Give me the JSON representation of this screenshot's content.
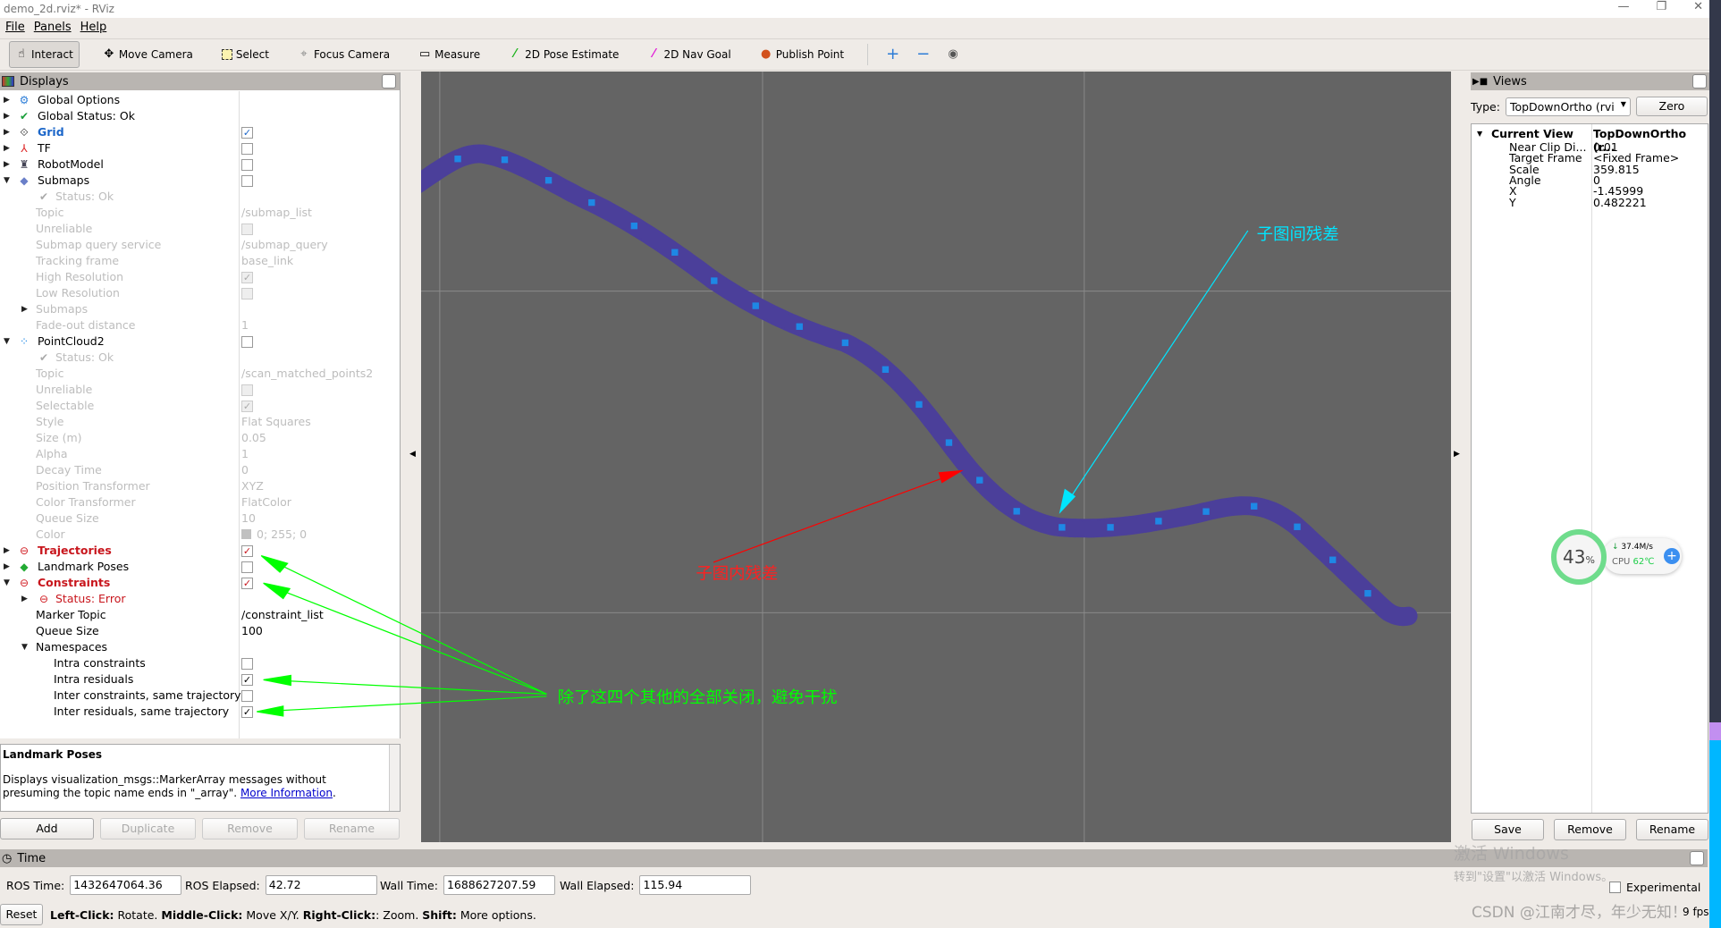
{
  "window": {
    "title": "demo_2d.rviz* - RViz",
    "controls": [
      "—",
      "❐",
      "✕"
    ]
  },
  "menu": [
    "File",
    "Panels",
    "Help"
  ],
  "toolbar": [
    {
      "label": "Interact",
      "icon": "hand-icon",
      "active": true
    },
    {
      "label": "Move Camera",
      "icon": "move-camera-icon"
    },
    {
      "label": "Select",
      "icon": "select-icon"
    },
    {
      "label": "Focus Camera",
      "icon": "focus-camera-icon"
    },
    {
      "label": "Measure",
      "icon": "ruler-icon"
    },
    {
      "label": "2D Pose Estimate",
      "icon": "green-arrow-icon"
    },
    {
      "label": "2D Nav Goal",
      "icon": "magenta-arrow-icon"
    },
    {
      "label": "Publish Point",
      "icon": "map-pin-icon"
    }
  ],
  "displays": {
    "title": "Displays",
    "rows": [
      {
        "label": "Global Options",
        "level": 0,
        "exp": "closed",
        "icon": "gear-icon"
      },
      {
        "label": "Global Status: Ok",
        "level": 0,
        "exp": "closed",
        "icon": "check-icon"
      },
      {
        "label": "Grid",
        "level": 0,
        "exp": "closed",
        "icon": "grid-icon",
        "style": "blue",
        "cb": "checked"
      },
      {
        "label": "TF",
        "level": 0,
        "exp": "closed",
        "icon": "tf-axes-icon",
        "cb": "unchecked"
      },
      {
        "label": "RobotModel",
        "level": 0,
        "exp": "closed",
        "icon": "robot-icon",
        "cb": "unchecked"
      },
      {
        "label": "Submaps",
        "level": 0,
        "exp": "open",
        "icon": "submaps-icon",
        "cb": "unchecked"
      },
      {
        "label": "Status: Ok",
        "level": 1,
        "icon": "check-icon",
        "style": "dis"
      },
      {
        "label": "Topic",
        "level": 1,
        "value": "/submap_list",
        "style": "dis"
      },
      {
        "label": "Unreliable",
        "level": 1,
        "cb": "unchecked",
        "style": "dis"
      },
      {
        "label": "Submap query service",
        "level": 1,
        "value": "/submap_query",
        "style": "dis"
      },
      {
        "label": "Tracking frame",
        "level": 1,
        "value": "base_link",
        "style": "dis"
      },
      {
        "label": "High Resolution",
        "level": 1,
        "cb": "checked",
        "style": "dis"
      },
      {
        "label": "Low Resolution",
        "level": 1,
        "cb": "unchecked",
        "style": "dis"
      },
      {
        "label": "Submaps",
        "level": 1,
        "exp": "closed",
        "style": "dis"
      },
      {
        "label": "Fade-out distance",
        "level": 1,
        "value": "1",
        "style": "dis"
      },
      {
        "label": "PointCloud2",
        "level": 0,
        "exp": "open",
        "icon": "pointcloud-icon",
        "cb": "unchecked"
      },
      {
        "label": "Status: Ok",
        "level": 1,
        "icon": "check-icon",
        "style": "dis"
      },
      {
        "label": "Topic",
        "level": 1,
        "value": "/scan_matched_points2",
        "style": "dis"
      },
      {
        "label": "Unreliable",
        "level": 1,
        "cb": "unchecked",
        "style": "dis"
      },
      {
        "label": "Selectable",
        "level": 1,
        "cb": "checked",
        "style": "dis"
      },
      {
        "label": "Style",
        "level": 1,
        "value": "Flat Squares",
        "style": "dis"
      },
      {
        "label": "Size (m)",
        "level": 1,
        "value": "0.05",
        "style": "dis"
      },
      {
        "label": "Alpha",
        "level": 1,
        "value": "1",
        "style": "dis"
      },
      {
        "label": "Decay Time",
        "level": 1,
        "value": "0",
        "style": "dis"
      },
      {
        "label": "Position Transformer",
        "level": 1,
        "value": "XYZ",
        "style": "dis"
      },
      {
        "label": "Color Transformer",
        "level": 1,
        "value": "FlatColor",
        "style": "dis"
      },
      {
        "label": "Queue Size",
        "level": 1,
        "value": "10",
        "style": "dis"
      },
      {
        "label": "Color",
        "level": 1,
        "value": "0; 255; 0",
        "swatch": "#c0c0c0",
        "style": "dis"
      },
      {
        "label": "Trajectories",
        "level": 0,
        "exp": "closed",
        "icon": "error-icon",
        "style": "red",
        "cb": "checked-red"
      },
      {
        "label": "Landmark Poses",
        "level": 0,
        "exp": "closed",
        "icon": "landmark-cubes-icon",
        "cb": "unchecked"
      },
      {
        "label": "Constraints",
        "level": 0,
        "exp": "open",
        "icon": "error-icon",
        "style": "red",
        "cb": "checked-red"
      },
      {
        "label": "Status: Error",
        "level": 1,
        "exp": "closed",
        "icon": "error-icon",
        "style": "redn"
      },
      {
        "label": "Marker Topic",
        "level": 1,
        "value": "/constraint_list"
      },
      {
        "label": "Queue Size",
        "level": 1,
        "value": "100"
      },
      {
        "label": "Namespaces",
        "level": 1,
        "exp": "open"
      },
      {
        "label": "Intra constraints",
        "level": 2,
        "cb": "unchecked"
      },
      {
        "label": "Intra residuals",
        "level": 2,
        "cb": "checked"
      },
      {
        "label": "Inter constraints, same trajectory",
        "level": 2,
        "cb": "unchecked"
      },
      {
        "label": "Inter residuals, same trajectory",
        "level": 2,
        "cb": "checked"
      }
    ],
    "description": {
      "title": "Landmark Poses",
      "text": "Displays visualization_msgs::MarkerArray messages without presuming the topic name ends in \"_array\".",
      "link": "More Information"
    },
    "buttons": {
      "add": "Add",
      "duplicate": "Duplicate",
      "remove": "Remove",
      "rename": "Rename"
    }
  },
  "viewport": {
    "annotations": {
      "inter": "子图间残差",
      "intra": "子图内残差",
      "note": "除了这四个其他的全部关闭，避免干扰"
    },
    "colors": {
      "background": "#646464",
      "path": "#4b3f9a",
      "poses": "#1e88e5",
      "inter_arrow": "#00e5ff",
      "intra_arrow": "#ff0000",
      "note": "#00ff00"
    }
  },
  "views": {
    "title": "Views",
    "type_label": "Type:",
    "type_value": "TopDownOrtho (rvi",
    "zero": "Zero",
    "current": {
      "label": "Current View",
      "value": "TopDownOrtho (r..."
    },
    "props": [
      {
        "k": "Near Clip Di...",
        "v": "0.01"
      },
      {
        "k": "Target Frame",
        "v": "<Fixed Frame>"
      },
      {
        "k": "Scale",
        "v": "359.815"
      },
      {
        "k": "Angle",
        "v": "0"
      },
      {
        "k": "X",
        "v": "-1.45999"
      },
      {
        "k": "Y",
        "v": "0.482221"
      }
    ],
    "buttons": {
      "save": "Save",
      "remove": "Remove",
      "rename": "Rename"
    }
  },
  "sysmon": {
    "cpu_load": "43",
    "unit": "%",
    "net": "37.4M/s",
    "cpu_label": "CPU",
    "temp": "62℃"
  },
  "time": {
    "title": "Time",
    "ros_time_label": "ROS Time:",
    "ros_time": "1432647064.36",
    "ros_elapsed_label": "ROS Elapsed:",
    "ros_elapsed": "42.72",
    "wall_time_label": "Wall Time:",
    "wall_time": "1688627207.59",
    "wall_elapsed_label": "Wall Elapsed:",
    "wall_elapsed": "115.94",
    "experimental": "Experimental"
  },
  "status": {
    "reset": "Reset",
    "hint_parts": [
      [
        "Left-Click:",
        " Rotate. "
      ],
      [
        "Middle-Click:",
        " Move X/Y. "
      ],
      [
        "Right-Click:",
        ": Zoom. "
      ],
      [
        "Shift:",
        " More options."
      ]
    ],
    "fps": "9 fps"
  },
  "watermarks": {
    "win1": "激活 Windows",
    "win2": "转到\"设置\"以激活 Windows。",
    "csdn": "CSDN @江南才尽，年少无知！"
  }
}
